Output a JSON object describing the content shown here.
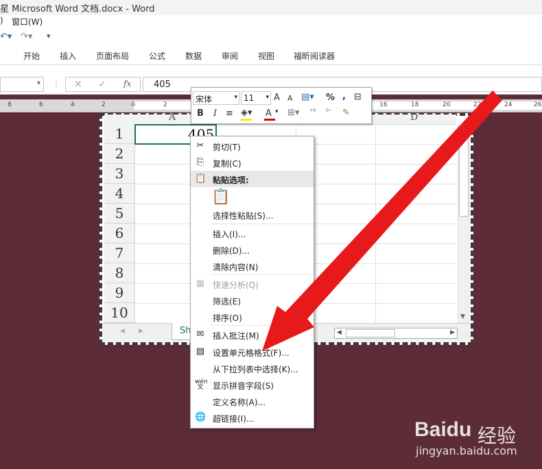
{
  "window": {
    "title": "星 Microsoft Word 文档.docx - Word"
  },
  "menubar": {
    "partial_item": ")",
    "window_menu": "窗口(W)"
  },
  "ribbon": {
    "tabs": [
      "开始",
      "插入",
      "页面布局",
      "公式",
      "数据",
      "审阅",
      "视图",
      "福昕阅读器"
    ]
  },
  "formula_bar": {
    "fx_label": "fx",
    "value": "405"
  },
  "ruler": {
    "numbers": [
      "8",
      "6",
      "4",
      "2",
      "2",
      "16",
      "18",
      "20",
      "22",
      "24",
      "26"
    ]
  },
  "sheet": {
    "row_headers": [
      "1",
      "2",
      "3",
      "4",
      "5",
      "6",
      "7",
      "8",
      "9",
      "10"
    ],
    "col_a": "A",
    "col_d": "D",
    "active_cell_value": "405",
    "sheet_tab_partial": "Sh"
  },
  "mini_toolbar": {
    "font_name": "宋体",
    "font_size": "11",
    "grow_font": "A",
    "shrink_font": "A",
    "percent": "%",
    "comma": ",",
    "bold": "B",
    "italic": "I",
    "font_color_letter": "A",
    "accent_red": "#e00000",
    "highlight_yellow": "#ffe600"
  },
  "context_menu": {
    "cut": "剪切(T)",
    "copy": "复制(C)",
    "paste_options": "粘贴选项:",
    "paste_special": "选择性粘贴(S)...",
    "insert": "插入(I)...",
    "delete": "删除(D)...",
    "clear_contents": "清除内容(N)",
    "quick_analysis": "快速分析(Q)",
    "filter": "筛选(E)",
    "sort": "排序(O)",
    "insert_comment": "插入批注(M)",
    "format_cells": "设置单元格格式(F)...",
    "pick_from_list": "从下拉列表中选择(K)...",
    "show_phonetic": "显示拼音字段(S)",
    "define_name": "定义名称(A)...",
    "hyperlink": "超链接(I)..."
  },
  "watermark": {
    "brand": "Baidu",
    "brand_cn": "经验",
    "url": "jingyan.baidu.com"
  },
  "colors": {
    "doc_background": "#5c2d38",
    "arrow_red": "#e8191a",
    "excel_green": "#217346"
  }
}
